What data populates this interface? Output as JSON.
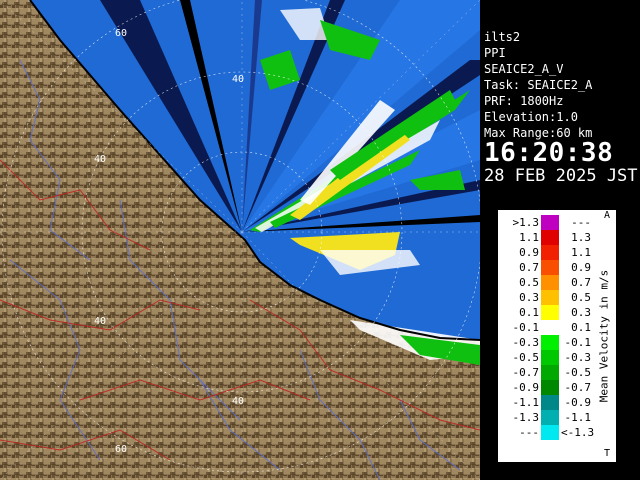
{
  "radar": {
    "ring_labels": [
      "60",
      "40",
      "40",
      "40",
      "40",
      "60"
    ],
    "colors": {
      "coverage": "#1f6ad4",
      "coverage_light": "#2d7ef0",
      "land": "#8a7250",
      "land_dark": "#5a4528",
      "echo_green": "#10c010",
      "echo_yellow": "#f0e020",
      "echo_white": "#ffffff"
    }
  },
  "info": {
    "site": "ilts2",
    "product": "PPI",
    "scan": "SEAICE2_A_V",
    "task": "Task: SEAICE2_A",
    "prf": "PRF: 1800Hz",
    "elevation": "Elevation:1.0",
    "max_range": "Max Range:60 km",
    "time": "16:20:38",
    "date": "28 FEB 2025 JST"
  },
  "legend": {
    "title": "Mean Velocity in m/s",
    "corner_top": "A",
    "corner_bottom": "T",
    "rows": [
      {
        "left": ">1.3",
        "right": "---",
        "color": "#c000c0"
      },
      {
        "left": "1.1",
        "right": "1.3",
        "color": "#e00000"
      },
      {
        "left": "0.9",
        "right": "1.1",
        "color": "#f02000"
      },
      {
        "left": "0.7",
        "right": "0.9",
        "color": "#f85000"
      },
      {
        "left": "0.5",
        "right": "0.7",
        "color": "#ff9000"
      },
      {
        "left": "0.3",
        "right": "0.5",
        "color": "#ffc000"
      },
      {
        "left": "0.1",
        "right": "0.3",
        "color": "#ffff00"
      },
      {
        "left": "-0.1",
        "right": "0.1",
        "color": "#ffffff"
      },
      {
        "left": "-0.3",
        "right": "-0.1",
        "color": "#00f000"
      },
      {
        "left": "-0.5",
        "right": "-0.3",
        "color": "#00c800"
      },
      {
        "left": "-0.7",
        "right": "-0.5",
        "color": "#00a800"
      },
      {
        "left": "-0.9",
        "right": "-0.7",
        "color": "#008800"
      },
      {
        "left": "-1.1",
        "right": "-0.9",
        "color": "#008888"
      },
      {
        "left": "-1.3",
        "right": "-1.1",
        "color": "#00b0b0"
      },
      {
        "left": "---",
        "right": "<-1.3",
        "color": "#00e8f0"
      }
    ]
  }
}
